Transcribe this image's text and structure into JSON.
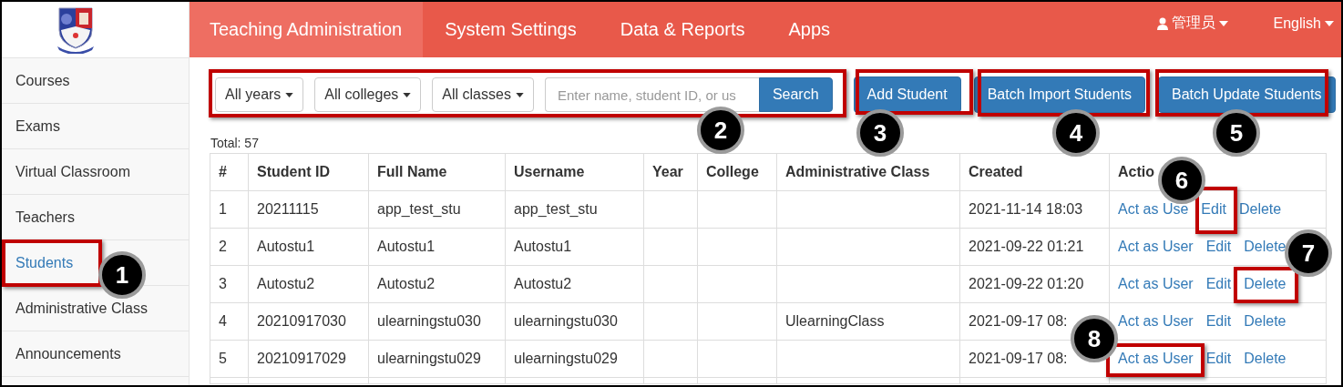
{
  "sidebar": {
    "items": [
      {
        "label": "Courses",
        "selected": false
      },
      {
        "label": "Exams",
        "selected": false
      },
      {
        "label": "Virtual Classroom",
        "selected": false
      },
      {
        "label": "Teachers",
        "selected": false
      },
      {
        "label": "Students",
        "selected": true
      },
      {
        "label": "Administrative Class",
        "selected": false
      },
      {
        "label": "Announcements",
        "selected": false
      }
    ]
  },
  "header": {
    "nav": [
      {
        "label": "Teaching Administration",
        "selected": true
      },
      {
        "label": "System Settings",
        "selected": false
      },
      {
        "label": "Data & Reports",
        "selected": false
      },
      {
        "label": "Apps",
        "selected": false
      }
    ],
    "user": "管理员",
    "language": "English"
  },
  "filters": {
    "dropdowns": [
      "All years",
      "All colleges",
      "All classes"
    ],
    "search": {
      "placeholder": "Enter name, student ID, or us",
      "button": "Search"
    }
  },
  "actions": [
    "Add Student",
    "Batch Import Students",
    "Batch Update Students"
  ],
  "total": "Total: 57",
  "table": {
    "columns": [
      "#",
      "Student ID",
      "Full Name",
      "Username",
      "Year",
      "College",
      "Administrative Class",
      "Created",
      "Actio"
    ],
    "rows": [
      {
        "cells": [
          "1",
          "20211115",
          "app_test_stu",
          "app_test_stu",
          "",
          "",
          "",
          "2021-11-14 18:03"
        ],
        "actions": [
          "Act as Use",
          "Edit",
          "Delete"
        ]
      },
      {
        "cells": [
          "2",
          "Autostu1",
          "Autostu1",
          "Autostu1",
          "",
          "",
          "",
          "2021-09-22 01:21"
        ],
        "actions": [
          "Act as User",
          "Edit",
          "Delete"
        ]
      },
      {
        "cells": [
          "3",
          "Autostu2",
          "Autostu2",
          "Autostu2",
          "",
          "",
          "",
          "2021-09-22 01:20"
        ],
        "actions": [
          "Act as User",
          "Edit",
          "Delete"
        ]
      },
      {
        "cells": [
          "4",
          "20210917030",
          "ulearningstu030",
          "ulearningstu030",
          "",
          "",
          "UlearningClass",
          "2021-09-17 08:"
        ],
        "actions": [
          "Act as User",
          "Edit",
          "Delete"
        ]
      },
      {
        "cells": [
          "5",
          "20210917029",
          "ulearningstu029",
          "ulearningstu029",
          "",
          "",
          "",
          "2021-09-17 08:"
        ],
        "actions": [
          "Act as User",
          "Edit",
          "Delete"
        ]
      }
    ]
  },
  "callouts": [
    "1",
    "2",
    "3",
    "4",
    "5",
    "6",
    "7",
    "8"
  ]
}
